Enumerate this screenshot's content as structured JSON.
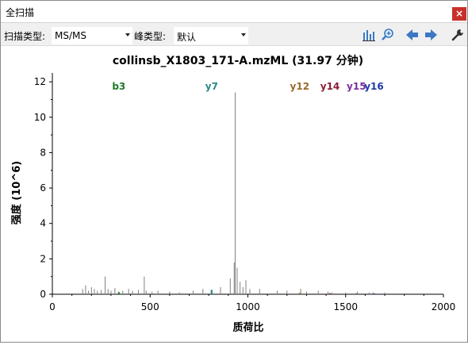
{
  "window": {
    "title": "全扫描",
    "close_label": "×"
  },
  "toolbar": {
    "scan_type_label": "扫描类型:",
    "scan_type_value": "MS/MS",
    "peak_type_label": "峰类型:",
    "peak_type_value": "默认",
    "icons": [
      "bar-chart-icon",
      "zoom-in-icon",
      "arrow-left-icon",
      "arrow-right-icon",
      "wrench-icon"
    ]
  },
  "colors": {
    "close": "#c8302b",
    "icon_blue": "#3b78c4",
    "axis": "#000000",
    "peak": "#808080"
  },
  "chart_data": {
    "type": "bar",
    "title": "collinsb_X1803_171-A.mzML (31.97 分钟)",
    "xlabel": "质荷比",
    "ylabel": "强度 (10^6)",
    "xlim": [
      0,
      2000
    ],
    "ylim": [
      0,
      12.5
    ],
    "xticks": [
      0,
      500,
      1000,
      1500,
      2000
    ],
    "yticks": [
      0,
      2,
      4,
      6,
      8,
      10,
      12
    ],
    "grid": false,
    "annotations": [
      {
        "label": "b3",
        "x": 340,
        "color": "#1f7a2a"
      },
      {
        "label": "y7",
        "x": 815,
        "color": "#2a8a86"
      },
      {
        "label": "y12",
        "x": 1265,
        "color": "#9c6a2a"
      },
      {
        "label": "y14",
        "x": 1420,
        "color": "#8b1f3a"
      },
      {
        "label": "y15",
        "x": 1555,
        "color": "#7a2f9c"
      },
      {
        "label": "y16",
        "x": 1645,
        "color": "#1f3aa8"
      }
    ],
    "x": [
      155,
      170,
      185,
      200,
      215,
      230,
      250,
      270,
      285,
      300,
      320,
      340,
      360,
      390,
      410,
      440,
      470,
      480,
      510,
      540,
      600,
      650,
      720,
      770,
      812,
      860,
      910,
      930,
      935,
      945,
      960,
      975,
      990,
      1010,
      1060,
      1150,
      1200,
      1270,
      1300,
      1360,
      1410,
      1430,
      1500,
      1560,
      1620,
      1640,
      1700
    ],
    "values": [
      0.3,
      0.5,
      0.2,
      0.4,
      0.3,
      0.2,
      0.25,
      1.0,
      0.3,
      0.2,
      0.35,
      0.15,
      0.2,
      0.3,
      0.2,
      0.25,
      1.0,
      0.2,
      0.15,
      0.2,
      0.15,
      0.1,
      0.2,
      0.3,
      0.25,
      0.4,
      0.9,
      1.8,
      11.4,
      1.5,
      0.7,
      0.4,
      0.8,
      0.3,
      0.3,
      0.2,
      0.2,
      0.3,
      0.15,
      0.2,
      0.15,
      0.1,
      0.1,
      0.15,
      0.1,
      0.1,
      0.1
    ],
    "colored_peaks": [
      {
        "x": 340,
        "value": 0.12,
        "color": "#1f7a2a"
      },
      {
        "x": 815,
        "value": 0.25,
        "color": "#2a8a86"
      },
      {
        "x": 1265,
        "value": 0.08,
        "color": "#9c6a2a"
      },
      {
        "x": 1420,
        "value": 0.06,
        "color": "#8b1f3a"
      },
      {
        "x": 1555,
        "value": 0.05,
        "color": "#7a2f9c"
      },
      {
        "x": 1645,
        "value": 0.05,
        "color": "#1f3aa8"
      }
    ]
  }
}
